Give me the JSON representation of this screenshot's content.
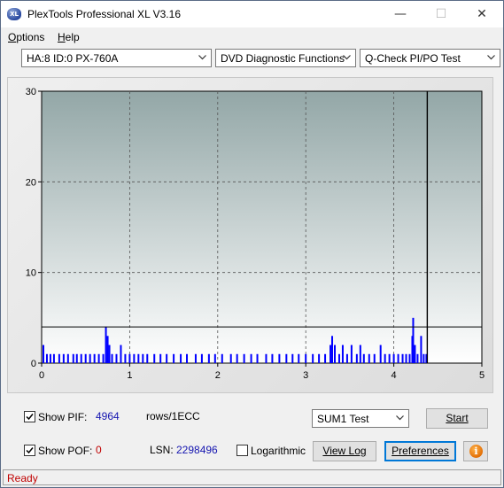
{
  "window": {
    "title": "PlexTools Professional XL V3.16",
    "icon_label": "XL",
    "controls": {
      "minimize": "—",
      "maximize": "☐",
      "close": "✕"
    }
  },
  "menu": [
    {
      "label": "Options",
      "accel": "O",
      "rest": "ptions"
    },
    {
      "label": "Help",
      "accel": "H",
      "rest": "elp"
    }
  ],
  "toolbar": {
    "drive": "HA:8 ID:0  PX-760A",
    "function": "DVD Diagnostic Functions",
    "test": "Q-Check PI/PO Test"
  },
  "chart_data": {
    "type": "bar",
    "xlim": [
      0,
      5
    ],
    "ylim": [
      0,
      30
    ],
    "x_ticks": [
      "0",
      "1",
      "2",
      "3",
      "4",
      "5"
    ],
    "y_ticks": [
      "0",
      "10",
      "20",
      "30"
    ],
    "grid": true,
    "end_marker_x": 4.38,
    "reference_line_y": 4,
    "background_top": "#93a7a7",
    "background_bottom": "#ffffff",
    "bar_color": "#0000ff",
    "series": [
      {
        "values": [
          {
            "x": 0.02,
            "y": 2
          },
          {
            "x": 0.06,
            "y": 1
          },
          {
            "x": 0.1,
            "y": 1
          },
          {
            "x": 0.14,
            "y": 1
          },
          {
            "x": 0.2,
            "y": 1
          },
          {
            "x": 0.25,
            "y": 1
          },
          {
            "x": 0.3,
            "y": 1
          },
          {
            "x": 0.36,
            "y": 1
          },
          {
            "x": 0.4,
            "y": 1
          },
          {
            "x": 0.45,
            "y": 1
          },
          {
            "x": 0.5,
            "y": 1
          },
          {
            "x": 0.55,
            "y": 1
          },
          {
            "x": 0.6,
            "y": 1
          },
          {
            "x": 0.65,
            "y": 1
          },
          {
            "x": 0.7,
            "y": 1
          },
          {
            "x": 0.73,
            "y": 4
          },
          {
            "x": 0.75,
            "y": 3
          },
          {
            "x": 0.77,
            "y": 2
          },
          {
            "x": 0.8,
            "y": 1
          },
          {
            "x": 0.85,
            "y": 1
          },
          {
            "x": 0.9,
            "y": 2
          },
          {
            "x": 0.95,
            "y": 1
          },
          {
            "x": 1.0,
            "y": 1
          },
          {
            "x": 1.05,
            "y": 1
          },
          {
            "x": 1.1,
            "y": 1
          },
          {
            "x": 1.15,
            "y": 1
          },
          {
            "x": 1.2,
            "y": 1
          },
          {
            "x": 1.28,
            "y": 1
          },
          {
            "x": 1.35,
            "y": 1
          },
          {
            "x": 1.42,
            "y": 1
          },
          {
            "x": 1.5,
            "y": 1
          },
          {
            "x": 1.58,
            "y": 1
          },
          {
            "x": 1.65,
            "y": 1
          },
          {
            "x": 1.75,
            "y": 1
          },
          {
            "x": 1.82,
            "y": 1
          },
          {
            "x": 1.9,
            "y": 1
          },
          {
            "x": 1.97,
            "y": 1
          },
          {
            "x": 2.05,
            "y": 1
          },
          {
            "x": 2.15,
            "y": 1
          },
          {
            "x": 2.22,
            "y": 1
          },
          {
            "x": 2.3,
            "y": 1
          },
          {
            "x": 2.38,
            "y": 1
          },
          {
            "x": 2.45,
            "y": 1
          },
          {
            "x": 2.55,
            "y": 1
          },
          {
            "x": 2.62,
            "y": 1
          },
          {
            "x": 2.7,
            "y": 1
          },
          {
            "x": 2.78,
            "y": 1
          },
          {
            "x": 2.85,
            "y": 1
          },
          {
            "x": 2.92,
            "y": 1
          },
          {
            "x": 3.0,
            "y": 1
          },
          {
            "x": 3.08,
            "y": 1
          },
          {
            "x": 3.15,
            "y": 1
          },
          {
            "x": 3.22,
            "y": 1
          },
          {
            "x": 3.28,
            "y": 2
          },
          {
            "x": 3.3,
            "y": 3
          },
          {
            "x": 3.33,
            "y": 2
          },
          {
            "x": 3.38,
            "y": 1
          },
          {
            "x": 3.42,
            "y": 2
          },
          {
            "x": 3.47,
            "y": 1
          },
          {
            "x": 3.52,
            "y": 2
          },
          {
            "x": 3.58,
            "y": 1
          },
          {
            "x": 3.62,
            "y": 2
          },
          {
            "x": 3.66,
            "y": 1
          },
          {
            "x": 3.72,
            "y": 1
          },
          {
            "x": 3.78,
            "y": 1
          },
          {
            "x": 3.85,
            "y": 2
          },
          {
            "x": 3.9,
            "y": 1
          },
          {
            "x": 3.95,
            "y": 1
          },
          {
            "x": 4.0,
            "y": 1
          },
          {
            "x": 4.05,
            "y": 1
          },
          {
            "x": 4.1,
            "y": 1
          },
          {
            "x": 4.14,
            "y": 1
          },
          {
            "x": 4.18,
            "y": 1
          },
          {
            "x": 4.21,
            "y": 3
          },
          {
            "x": 4.22,
            "y": 5
          },
          {
            "x": 4.24,
            "y": 2
          },
          {
            "x": 4.27,
            "y": 1
          },
          {
            "x": 4.31,
            "y": 3
          },
          {
            "x": 4.34,
            "y": 1
          },
          {
            "x": 4.37,
            "y": 1
          }
        ]
      }
    ]
  },
  "controls": {
    "show_pif_label": "Show PIF:",
    "show_pif_checked": true,
    "pif_value": "4964",
    "rows_label": "rows/1ECC",
    "show_pof_label": "Show POF:",
    "show_pof_checked": true,
    "pof_value": "0",
    "lsn_label": "LSN:",
    "lsn_value": "2298496",
    "logarithmic_label": "Logarithmic",
    "logarithmic_checked": false,
    "sum_select": "SUM1 Test",
    "start_button": "Start",
    "view_log_button": "View Log",
    "preferences_button": "Preferences",
    "info_icon": "i"
  },
  "status": {
    "text": "Ready"
  }
}
